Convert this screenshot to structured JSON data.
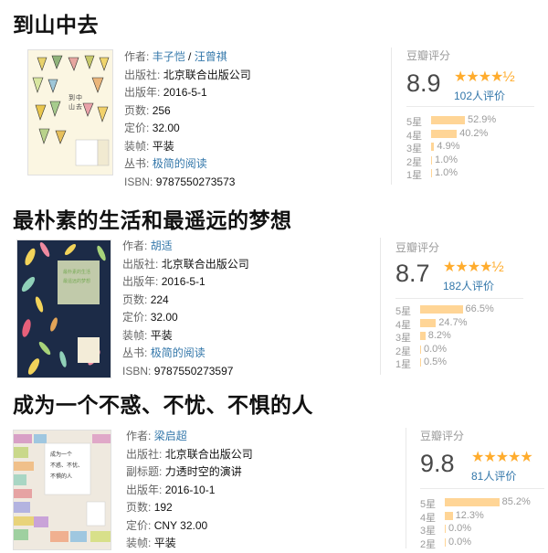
{
  "books": [
    {
      "title": "到山中去",
      "author_label": "作者:",
      "authors": [
        "丰子恺",
        "汪曾祺"
      ],
      "author_sep": " / ",
      "fields": [
        {
          "label": "出版社:",
          "value": "北京联合出版公司"
        },
        {
          "label": "出版年:",
          "value": "2016-5-1"
        },
        {
          "label": "页数:",
          "value": "256"
        },
        {
          "label": "定价:",
          "value": "32.00"
        },
        {
          "label": "装帧:",
          "value": "平装"
        }
      ],
      "series_label": "丛书:",
      "series_value": "极简的阅读",
      "isbn_label": "ISBN:",
      "isbn_value": "9787550273573",
      "rating_label": "豆瓣评分",
      "score": "8.9",
      "stars_text": "★★★★½",
      "stars_value": 4.5,
      "count": "102人评价",
      "distribution": [
        {
          "label": "5星",
          "pct": "52.9%",
          "value": 52.9
        },
        {
          "label": "4星",
          "pct": "40.2%",
          "value": 40.2
        },
        {
          "label": "3星",
          "pct": "4.9%",
          "value": 4.9
        },
        {
          "label": "2星",
          "pct": "1.0%",
          "value": 1.0
        },
        {
          "label": "1星",
          "pct": "1.0%",
          "value": 1.0
        }
      ]
    },
    {
      "title": "最朴素的生活和最遥远的梦想",
      "author_label": "作者:",
      "authors": [
        "胡适"
      ],
      "fields": [
        {
          "label": "出版社:",
          "value": "北京联合出版公司"
        },
        {
          "label": "出版年:",
          "value": "2016-5-1"
        },
        {
          "label": "页数:",
          "value": "224"
        },
        {
          "label": "定价:",
          "value": "32.00"
        },
        {
          "label": "装帧:",
          "value": "平装"
        }
      ],
      "series_label": "丛书:",
      "series_value": "极简的阅读",
      "isbn_label": "ISBN:",
      "isbn_value": "9787550273597",
      "rating_label": "豆瓣评分",
      "score": "8.7",
      "stars_text": "★★★★½",
      "stars_value": 4.5,
      "count": "182人评价",
      "distribution": [
        {
          "label": "5星",
          "pct": "66.5%",
          "value": 66.5
        },
        {
          "label": "4星",
          "pct": "24.7%",
          "value": 24.7
        },
        {
          "label": "3星",
          "pct": "8.2%",
          "value": 8.2
        },
        {
          "label": "2星",
          "pct": "0.0%",
          "value": 0.0
        },
        {
          "label": "1星",
          "pct": "0.5%",
          "value": 0.5
        }
      ]
    },
    {
      "title": "成为一个不惑、不忧、不惧的人",
      "author_label": "作者:",
      "authors": [
        "梁启超"
      ],
      "fields": [
        {
          "label": "出版社:",
          "value": "北京联合出版公司"
        },
        {
          "label": "副标题:",
          "value": "力透时空的演讲"
        },
        {
          "label": "出版年:",
          "value": "2016-10-1"
        },
        {
          "label": "页数:",
          "value": "192"
        },
        {
          "label": "定价:",
          "value": "CNY 32.00"
        },
        {
          "label": "装帧:",
          "value": "平装"
        }
      ],
      "rating_label": "豆瓣评分",
      "score": "9.8",
      "stars_text": "★★★★★",
      "stars_value": 5,
      "count": "81人评价",
      "distribution": [
        {
          "label": "5星",
          "pct": "85.2%",
          "value": 85.2
        },
        {
          "label": "4星",
          "pct": "12.3%",
          "value": 12.3
        },
        {
          "label": "3星",
          "pct": "0.0%",
          "value": 0.0
        },
        {
          "label": "2星",
          "pct": "0.0%",
          "value": 0.0
        }
      ]
    }
  ],
  "colors": {
    "link": "#3377aa",
    "star": "#ffac2d",
    "bar": "#ffd596",
    "muted": "#9b9b9b"
  },
  "icons": [
    "star-icon",
    "half-star-icon"
  ]
}
